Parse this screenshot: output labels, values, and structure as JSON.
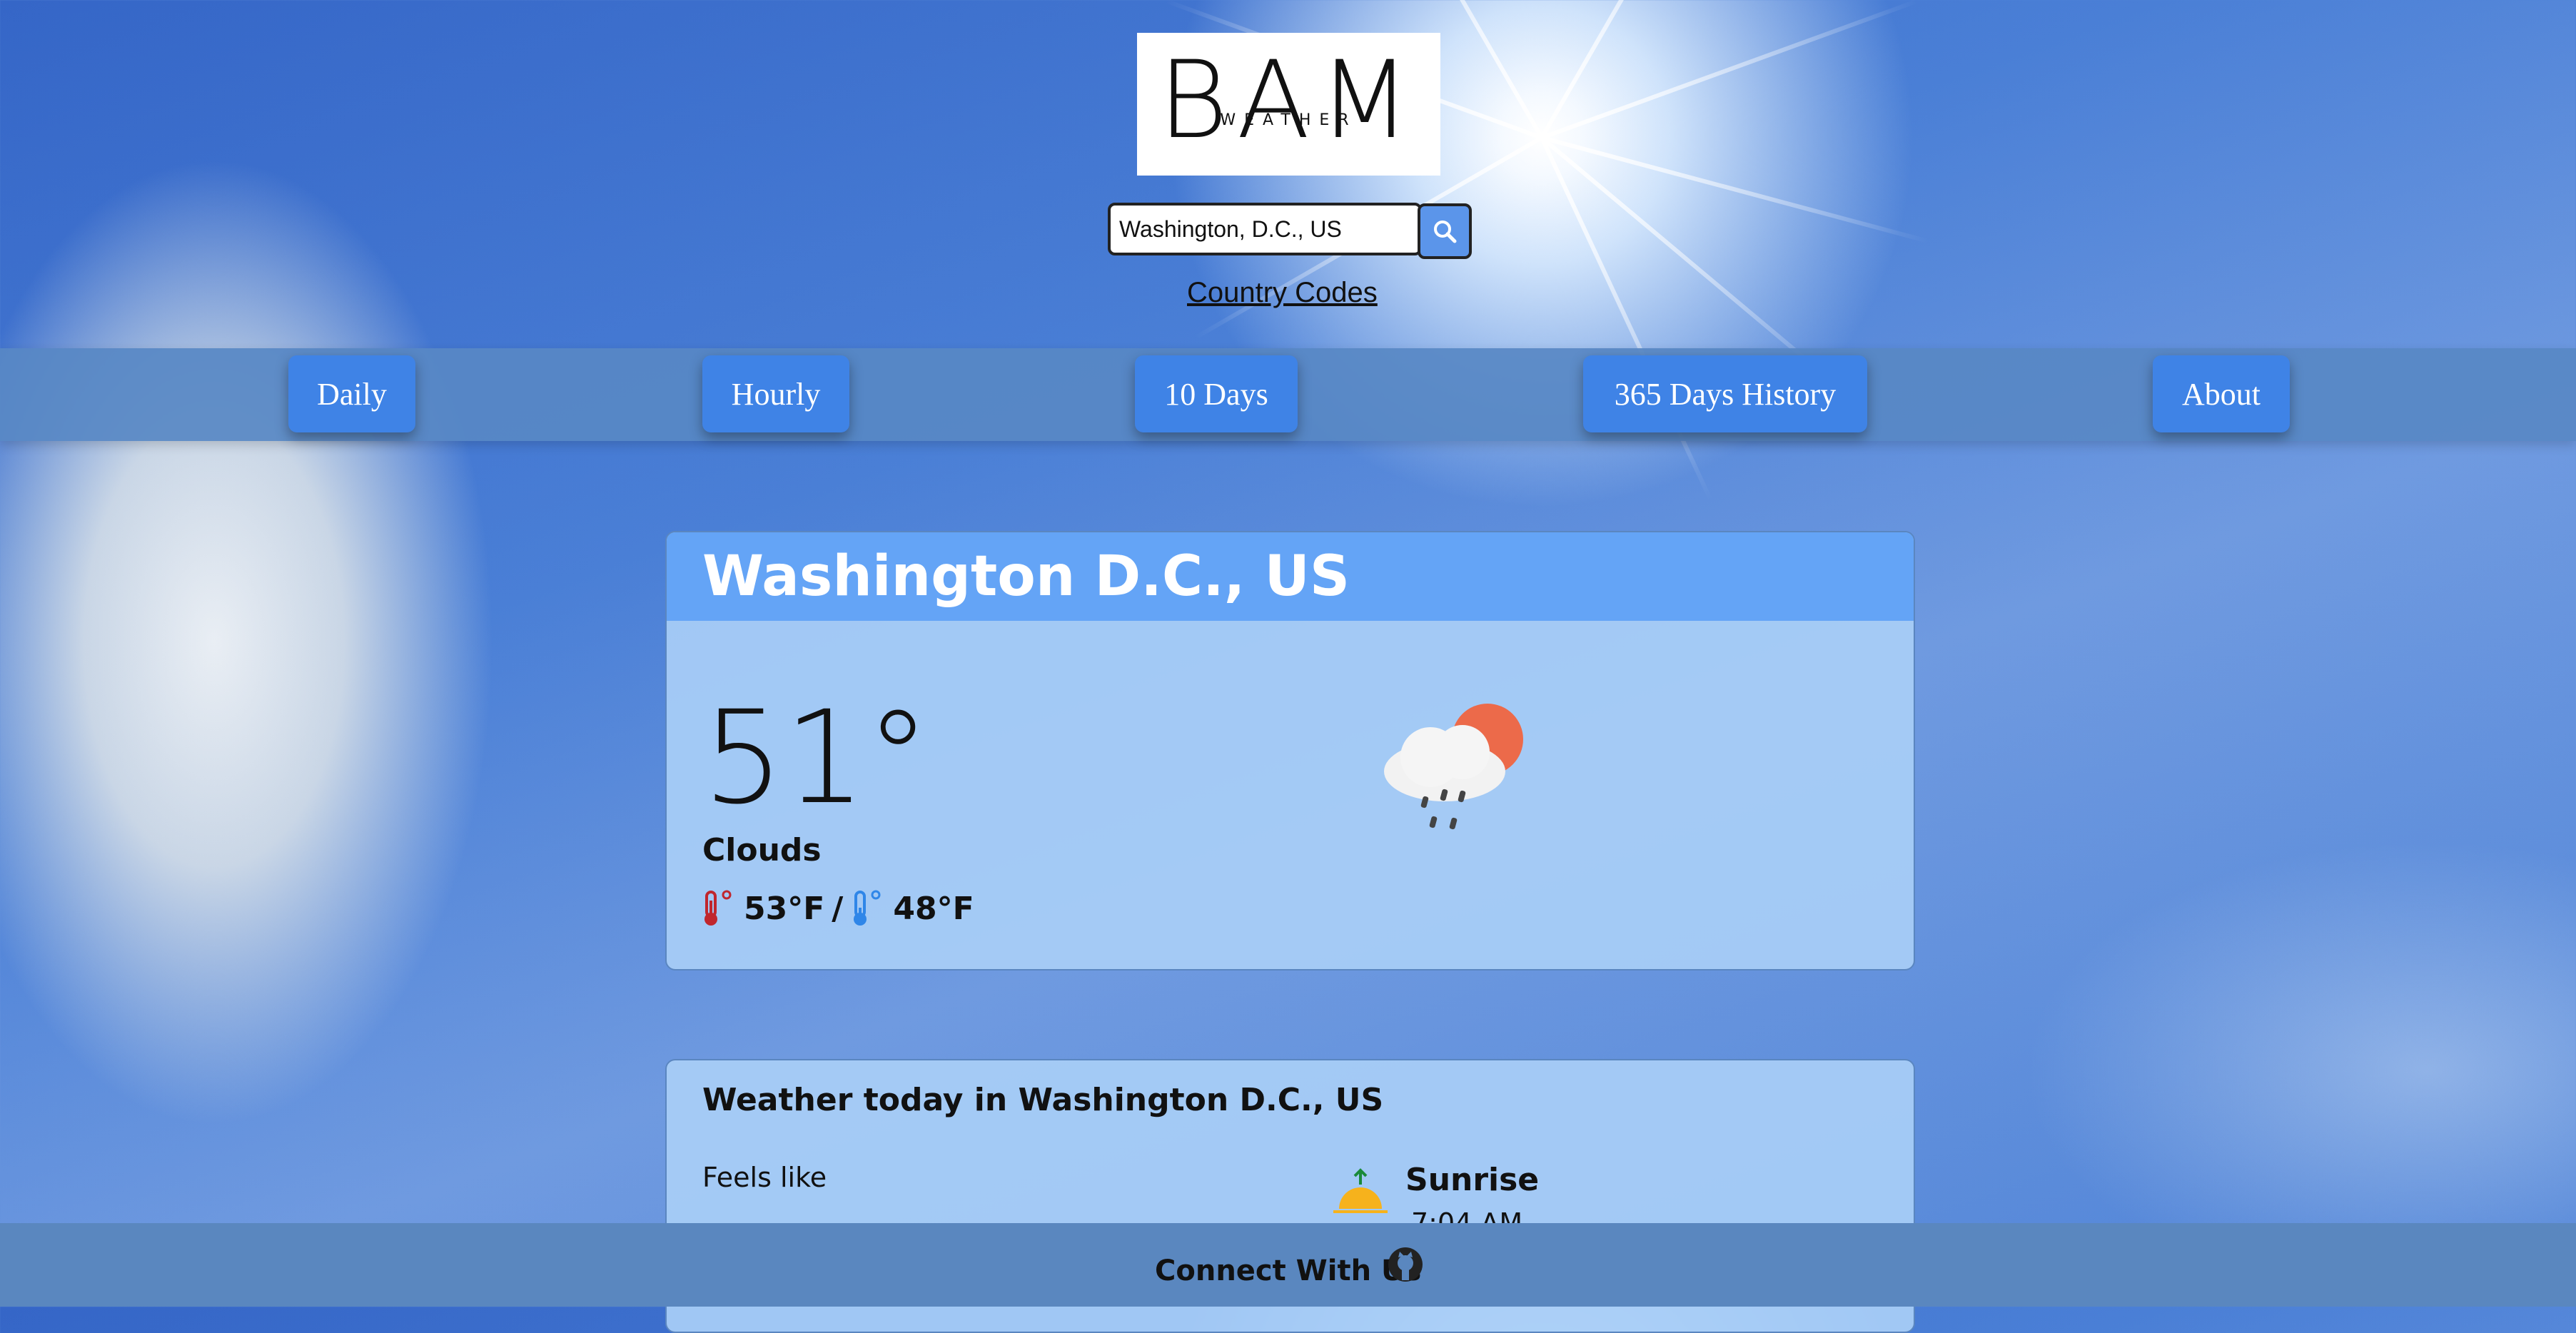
{
  "header": {
    "logo_main": "BAM",
    "logo_sub": "WEATHER",
    "search": {
      "value": "Washington, D.C., US"
    },
    "country_codes_link": "Country Codes"
  },
  "nav": {
    "items": [
      {
        "label": "Daily"
      },
      {
        "label": "Hourly"
      },
      {
        "label": "10 Days"
      },
      {
        "label": "365 Days History"
      },
      {
        "label": "About"
      }
    ]
  },
  "current": {
    "location": "Washington D.C., US",
    "temperature": "51°",
    "condition": "Clouds",
    "high": "53°F",
    "separator": "/",
    "low": "48°F",
    "icon": "rain-cloud-sun-icon"
  },
  "today": {
    "title": "Weather today in Washington D.C., US",
    "feels_like_label": "Feels like",
    "sunrise_label": "Sunrise",
    "sunrise_time": "7:04 AM"
  },
  "footer": {
    "connect_label": "Connect With Us",
    "icon": "github-icon"
  },
  "colors": {
    "nav_button": "#3f83e6",
    "card_header": "#64a4f6",
    "card_body": "#a8cef6",
    "footer": "#5a87bf"
  }
}
